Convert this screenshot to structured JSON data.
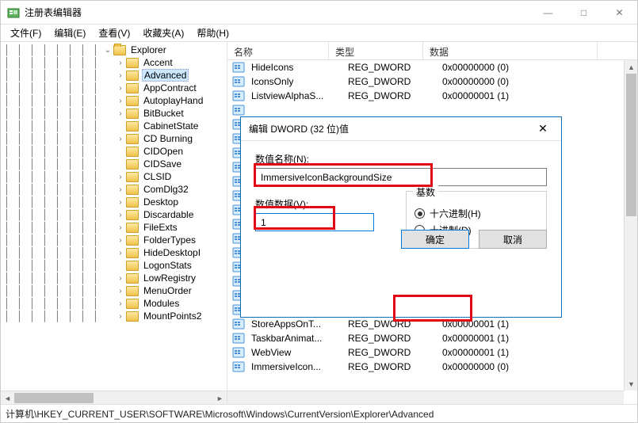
{
  "window": {
    "title": "注册表编辑器",
    "minimize": "—",
    "maximize": "□",
    "close": "✕"
  },
  "menu": {
    "file": "文件(F)",
    "edit": "编辑(E)",
    "view": "查看(V)",
    "favorites": "收藏夹(A)",
    "help": "帮助(H)"
  },
  "tree": {
    "root": "Explorer",
    "items": [
      {
        "label": "Accent",
        "expandable": true
      },
      {
        "label": "Advanced",
        "expandable": true,
        "selected": true
      },
      {
        "label": "AppContract",
        "expandable": true
      },
      {
        "label": "AutoplayHand",
        "expandable": true
      },
      {
        "label": "BitBucket",
        "expandable": true
      },
      {
        "label": "CabinetState",
        "expandable": false
      },
      {
        "label": "CD Burning",
        "expandable": true
      },
      {
        "label": "CIDOpen",
        "expandable": false
      },
      {
        "label": "CIDSave",
        "expandable": false
      },
      {
        "label": "CLSID",
        "expandable": true
      },
      {
        "label": "ComDlg32",
        "expandable": true
      },
      {
        "label": "Desktop",
        "expandable": true
      },
      {
        "label": "Discardable",
        "expandable": true
      },
      {
        "label": "FileExts",
        "expandable": true
      },
      {
        "label": "FolderTypes",
        "expandable": true
      },
      {
        "label": "HideDesktopI",
        "expandable": true
      },
      {
        "label": "LogonStats",
        "expandable": false
      },
      {
        "label": "LowRegistry",
        "expandable": true
      },
      {
        "label": "MenuOrder",
        "expandable": true
      },
      {
        "label": "Modules",
        "expandable": true
      },
      {
        "label": "MountPoints2",
        "expandable": true
      }
    ]
  },
  "list": {
    "headers": {
      "name": "名称",
      "type": "类型",
      "data": "数据"
    },
    "rows": [
      {
        "name": "HideIcons",
        "type": "REG_DWORD",
        "data": "0x00000000 (0)"
      },
      {
        "name": "IconsOnly",
        "type": "REG_DWORD",
        "data": "0x00000000 (0)"
      },
      {
        "name": "ListviewAlphaS...",
        "type": "REG_DWORD",
        "data": "0x00000001 (1)"
      },
      {
        "name": "",
        "type": "",
        "data": ""
      },
      {
        "name": "",
        "type": "",
        "data": ""
      },
      {
        "name": "",
        "type": "",
        "data": ""
      },
      {
        "name": "",
        "type": "",
        "data": ""
      },
      {
        "name": "",
        "type": "",
        "data": ""
      },
      {
        "name": "",
        "type": "",
        "data": ""
      },
      {
        "name": "",
        "type": "",
        "data": ""
      },
      {
        "name": "",
        "type": "",
        "data": ""
      },
      {
        "name": "",
        "type": "",
        "data": ""
      },
      {
        "name": "",
        "type": "",
        "data": ""
      },
      {
        "name": "",
        "type": "",
        "data": ""
      },
      {
        "name": "",
        "type": "",
        "data": ""
      },
      {
        "name": "",
        "type": "",
        "data": ""
      },
      {
        "name": "",
        "type": "",
        "data": ""
      },
      {
        "name": "",
        "type": "",
        "data": ""
      },
      {
        "name": "StoreAppsOnT...",
        "type": "REG_DWORD",
        "data": "0x00000001 (1)"
      },
      {
        "name": "TaskbarAnimat...",
        "type": "REG_DWORD",
        "data": "0x00000001 (1)"
      },
      {
        "name": "WebView",
        "type": "REG_DWORD",
        "data": "0x00000001 (1)"
      },
      {
        "name": "ImmersiveIcon...",
        "type": "REG_DWORD",
        "data": "0x00000000 (0)"
      }
    ]
  },
  "dialog": {
    "title": "编辑 DWORD (32 位)值",
    "name_label": "数值名称(N):",
    "name_value": "ImmersiveIconBackgroundSize",
    "data_label": "数值数据(V):",
    "data_value": "1",
    "radix_label": "基数",
    "hex_label": "十六进制(H)",
    "dec_label": "十进制(D)",
    "ok": "确定",
    "cancel": "取消",
    "close": "✕"
  },
  "statusbar": {
    "path": "计算机\\HKEY_CURRENT_USER\\SOFTWARE\\Microsoft\\Windows\\CurrentVersion\\Explorer\\Advanced"
  }
}
